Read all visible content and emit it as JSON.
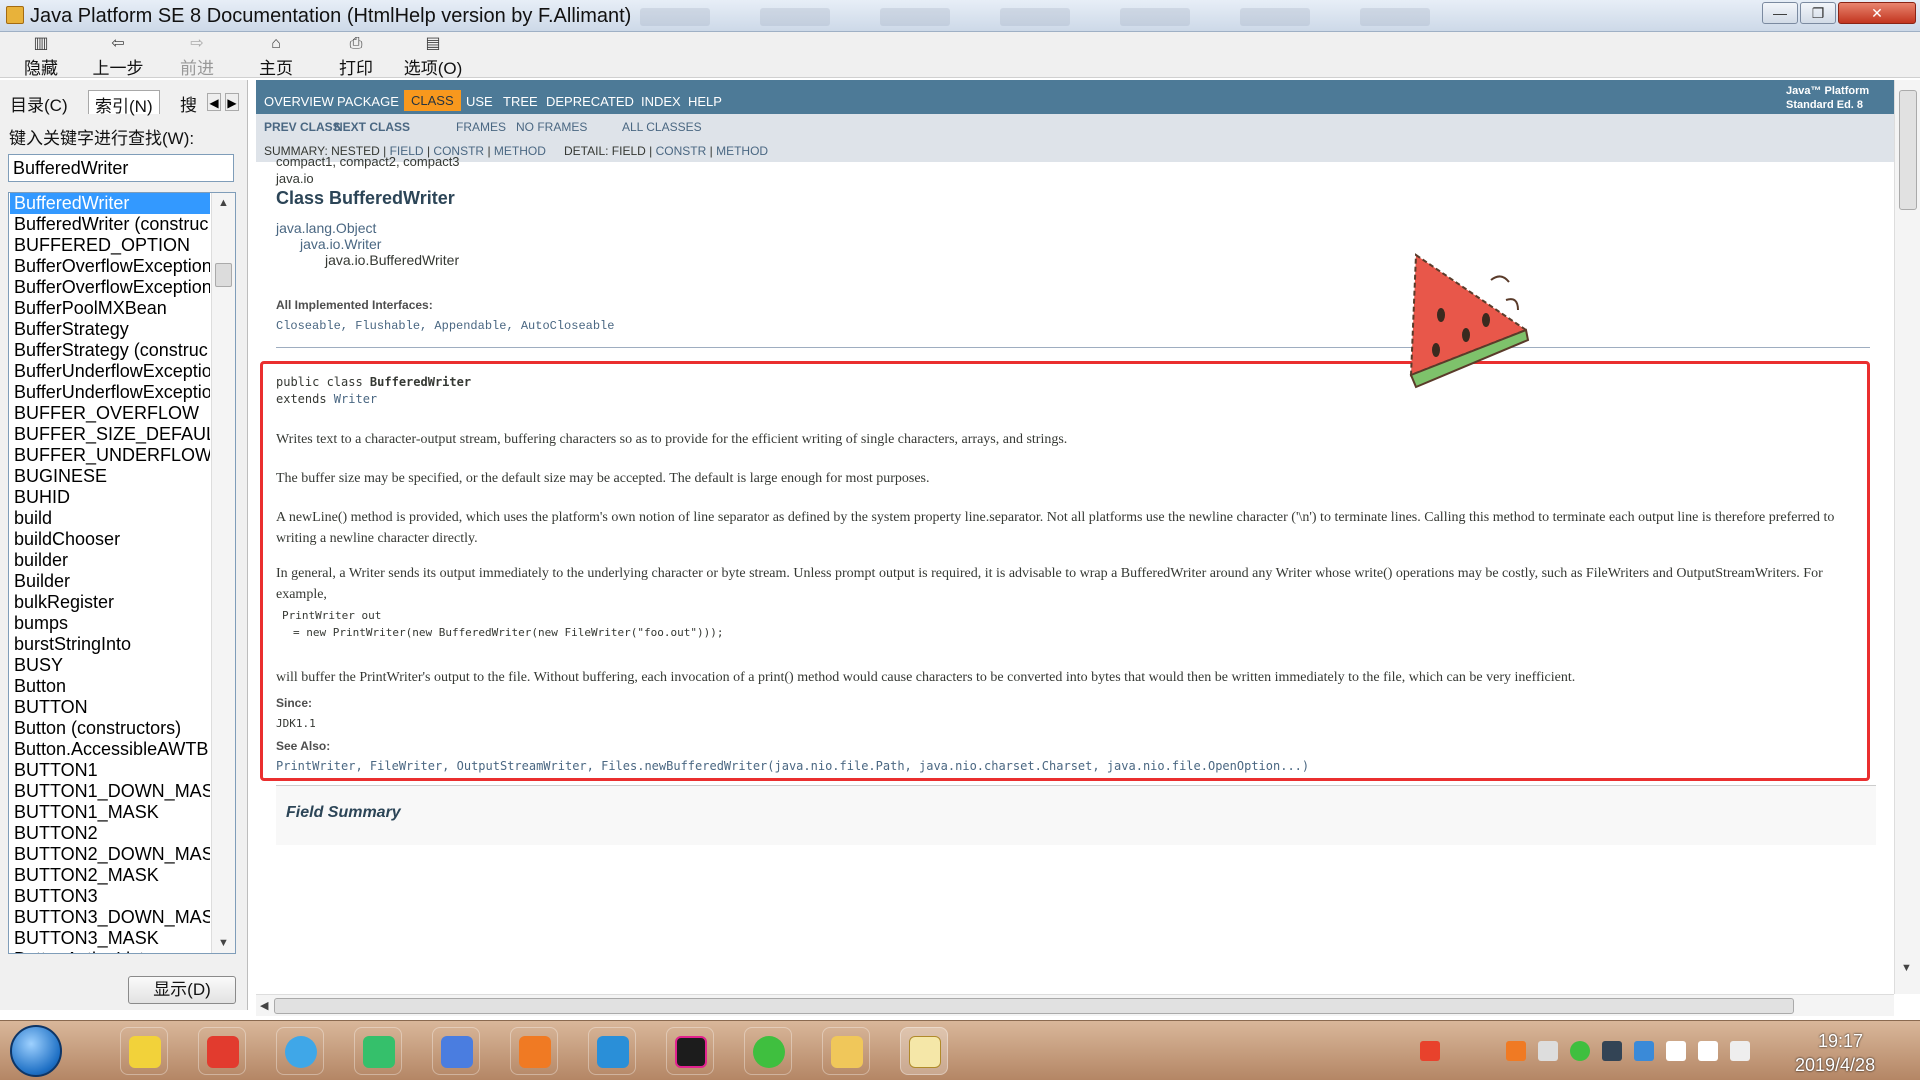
{
  "window": {
    "title": "Java Platform SE 8 Documentation (HtmlHelp version by F.Allimant)",
    "controls": {
      "minimize": "—",
      "maximize": "❐",
      "close": "✕"
    }
  },
  "toolbar": {
    "hide": "隐藏",
    "back": "上一步",
    "forward": "前进",
    "home": "主页",
    "print": "打印",
    "options": "选项(O)"
  },
  "left_pane": {
    "tabs": [
      "目录(C)",
      "索引(N)",
      "搜索"
    ],
    "active_tab": "索引(N)",
    "search_label": "键入关键字进行查找(W):",
    "search_value": "BufferedWriter",
    "items": [
      "BufferedWriter",
      "BufferedWriter (construc",
      "BUFFERED_OPTION",
      "BufferOverflowException",
      "BufferOverflowException",
      "BufferPoolMXBean",
      "BufferStrategy",
      "BufferStrategy (construc",
      "BufferUnderflowExceptio",
      "BufferUnderflowExceptio",
      "BUFFER_OVERFLOW",
      "BUFFER_SIZE_DEFAUL",
      "BUFFER_UNDERFLOW",
      "BUGINESE",
      "BUHID",
      "build",
      "buildChooser",
      "builder",
      "Builder",
      "bulkRegister",
      "bumps",
      "burstStringInto",
      "BUSY",
      "Button",
      "BUTTON",
      "Button (constructors)",
      "Button.AccessibleAWTB",
      "BUTTON1",
      "BUTTON1_DOWN_MAS",
      "BUTTON1_MASK",
      "BUTTON2",
      "BUTTON2_DOWN_MAS",
      "BUTTON2_MASK",
      "BUTTON3",
      "BUTTON3_DOWN_MAS",
      "BUTTON3_MASK",
      "ButtonActionListener"
    ],
    "display_button": "显示(D)"
  },
  "doc": {
    "nav": {
      "links": [
        "OVERVIEW",
        "PACKAGE",
        "CLASS",
        "USE",
        "TREE",
        "DEPRECATED",
        "INDEX",
        "HELP"
      ],
      "active": "CLASS",
      "about_line1": "Java™ Platform",
      "about_line2": "Standard Ed. 8"
    },
    "subnav": {
      "prev_class": "PREV CLASS",
      "next_class": "NEXT CLASS",
      "frames": "FRAMES",
      "no_frames": "NO FRAMES",
      "all_classes": "ALL CLASSES",
      "summary_prefix": "SUMMARY: NESTED |",
      "summary_field": "FIELD",
      "summary_sep1": "|",
      "summary_constr": "CONSTR",
      "summary_sep2": "|",
      "summary_method": "METHOD",
      "detail_prefix": "DETAIL: FIELD |",
      "detail_constr": "CONSTR",
      "detail_sep": "|",
      "detail_method": "METHOD"
    },
    "profiles": "compact1, compact2, compact3",
    "package": "java.io",
    "class_title": "Class BufferedWriter",
    "inheritance": [
      "java.lang.Object",
      "java.io.Writer",
      "java.io.BufferedWriter"
    ],
    "impl_label": "All Implemented Interfaces:",
    "impl_interfaces": "Closeable, Flushable, Appendable, AutoCloseable",
    "declaration_line1_prefix": "public class ",
    "declaration_line1_name": "BufferedWriter",
    "declaration_line2_prefix": "extends ",
    "declaration_line2_link": "Writer",
    "paragraphs": [
      "Writes text to a character-output stream, buffering characters so as to provide for the efficient writing of single characters, arrays, and strings.",
      "The buffer size may be specified, or the default size may be accepted. The default is large enough for most purposes.",
      "A newLine() method is provided, which uses the platform's own notion of line separator as defined by the system property line.separator. Not all platforms use the newline character ('\\n') to terminate lines. Calling this method to terminate each output line is therefore preferred to writing a newline character directly.",
      "In general, a Writer sends its output immediately to the underlying character or byte stream. Unless prompt output is required, it is advisable to wrap a BufferedWriter around any Writer whose write() operations may be costly, such as FileWriters and OutputStreamWriters. For example,",
      "will buffer the PrintWriter's output to the file. Without buffering, each invocation of a print() method would cause characters to be converted into bytes that would then be written immediately to the file, which can be very inefficient."
    ],
    "code_line1": "PrintWriter out",
    "code_line2": "= new PrintWriter(new BufferedWriter(new FileWriter(\"foo.out\")));",
    "since_label": "Since:",
    "since_value": "JDK1.1",
    "see_also_label": "See Also:",
    "see_also": "PrintWriter, FileWriter, OutputStreamWriter, Files.newBufferedWriter(java.nio.file.Path, java.nio.charset.Charset, java.nio.file.OpenOption...)",
    "field_summary": "Field Summary"
  },
  "taskbar": {
    "time": "19:17",
    "date": "2019/4/28"
  },
  "colors": {
    "nav_bg": "#4d7a97",
    "nav_active": "#f8981d",
    "link": "#4a6782",
    "highlight_border": "#ea2f2f"
  }
}
